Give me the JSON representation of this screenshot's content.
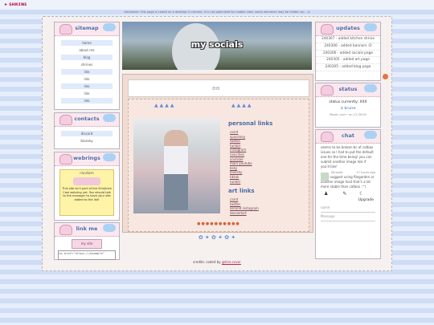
{
  "topbar": {
    "logo": "▸ ꜱʜʀɪɴᴇ"
  },
  "disclaimer": "disclaimer: this page is coded on a desktop in chrome, it is not optimized for mobile view. some elements may be hidden by... :p",
  "sitemap": {
    "title": "sitemap",
    "items": [
      "home",
      "about me",
      "blog",
      "shrines",
      "link",
      "link",
      "link",
      "link",
      "link"
    ]
  },
  "contacts": {
    "title": "contacts",
    "items": [
      "discord",
      "bluesky"
    ]
  },
  "webrings": {
    "title": "webrings",
    "ring_name": "random",
    "text": "This site isn't part of the ShinJinee Cast webring yet. You should talk to the manager to have your site added to the list!"
  },
  "linkme": {
    "title": "link me",
    "button_text": "my site",
    "code": "<a href=\"https://example\""
  },
  "hero": {
    "title": "my socials"
  },
  "personal_links": {
    "title": "personal links",
    "items": [
      "carrd",
      "spacehey",
      "twitter",
      "tumblr",
      "instagram",
      "neocities",
      "youtube",
      "main youtube",
      "bsky",
      "bluesky",
      "tiktok",
      "tumblr"
    ]
  },
  "art_links": {
    "title": "art links",
    "items": [
      "carrd",
      "twitter",
      "second instagram",
      "deviantart"
    ]
  },
  "updates": {
    "title": "updates",
    "items": [
      "240307 - added kitchen shrine",
      "240306 - added banners :D",
      "240306 - added socials page",
      "240305 - added art page",
      "240305 - added blog page"
    ]
  },
  "status": {
    "title": "status",
    "line1": "status currently: XXX",
    "mood": "is bruise",
    "time": "Mood: cool • on 12:30:00"
  },
  "chat": {
    "title": "chat",
    "message": "seems to be broken bc of catbox issues so I had to put the default one for the time being! you can submit another image link if you'd like!",
    "reply_author": "Miranda",
    "reply_time": "17 hours ago",
    "reply_text": "also I suggest using filegarden or another image host that's a lot more stable than catbox :^)",
    "upgrade": "Upgrade",
    "name_label": "name",
    "message_placeholder": "Message"
  },
  "credits": {
    "prefix": "credits: coded by",
    "author": "@hiro.cover"
  }
}
